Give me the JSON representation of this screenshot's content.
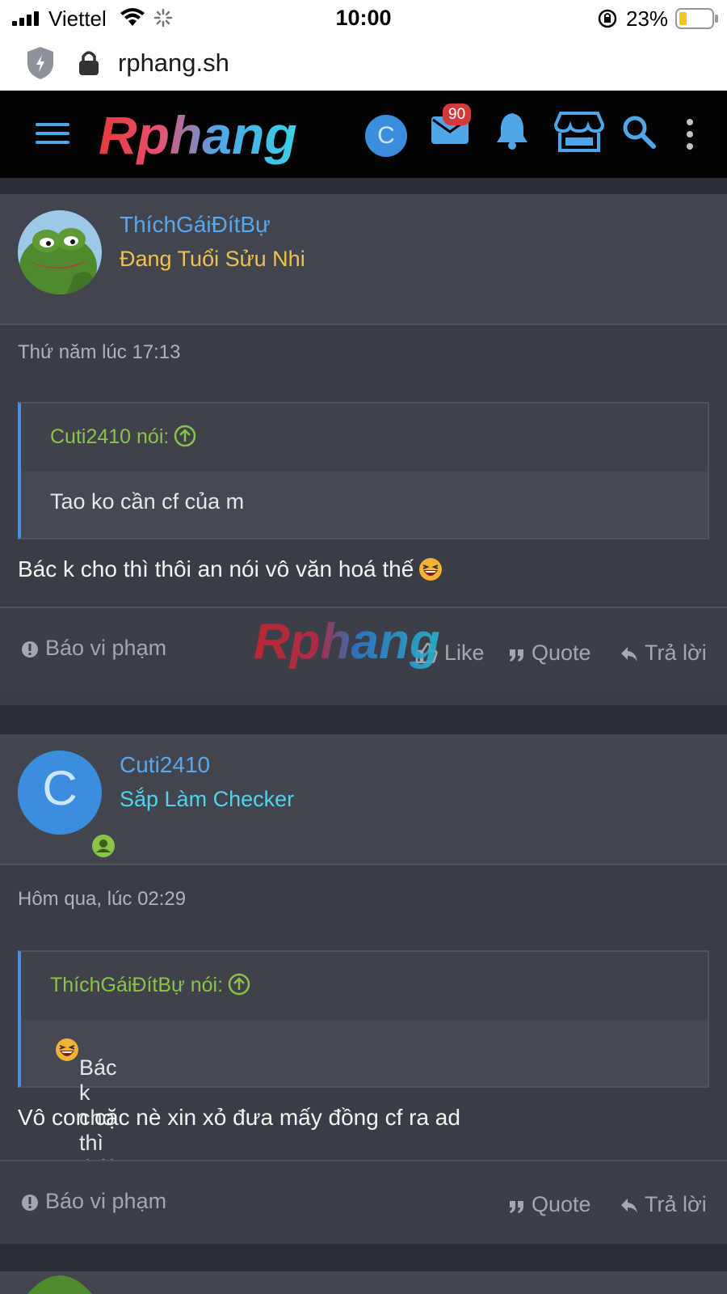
{
  "status_bar": {
    "carrier": "Viettel",
    "time": "10:00",
    "battery_percent": "23%"
  },
  "browser": {
    "url": "rphang.sh"
  },
  "site_header": {
    "logo_text": "Rphang",
    "user_initial": "C",
    "mail_count": "90"
  },
  "posts": [
    {
      "username": "ThíchGáiĐítBự",
      "user_title": "Đang Tuổi Sửu Nhi",
      "user_title_color": "#f0c24b",
      "timestamp": "Thứ năm lúc 17:13",
      "quote_author": "Cuti2410 nói:",
      "quote_text": "Tao ko cần cf của m",
      "message": "Bác k cho thì thôi an nói vô văn hoá thế",
      "actions": {
        "report": "Báo vi phạm",
        "like": "Like",
        "quote": "Quote",
        "reply": "Trả lời"
      }
    },
    {
      "username": "Cuti2410",
      "user_initial": "C",
      "user_title": "Sắp Làm Checker",
      "user_title_color": "#4fd4e8",
      "timestamp": "Hôm qua, lúc 02:29",
      "quote_author": "ThíchGáiĐítBự nói:",
      "quote_text": "Bác k cho thì thôi an nói vô văn hoá thế",
      "message": "Vô con cặc nè xin xỏ đưa mấy đồng cf ra ad",
      "actions": {
        "report": "Báo vi phạm",
        "quote": "Quote",
        "reply": "Trả lời"
      }
    }
  ],
  "watermark_text": "Rphang"
}
